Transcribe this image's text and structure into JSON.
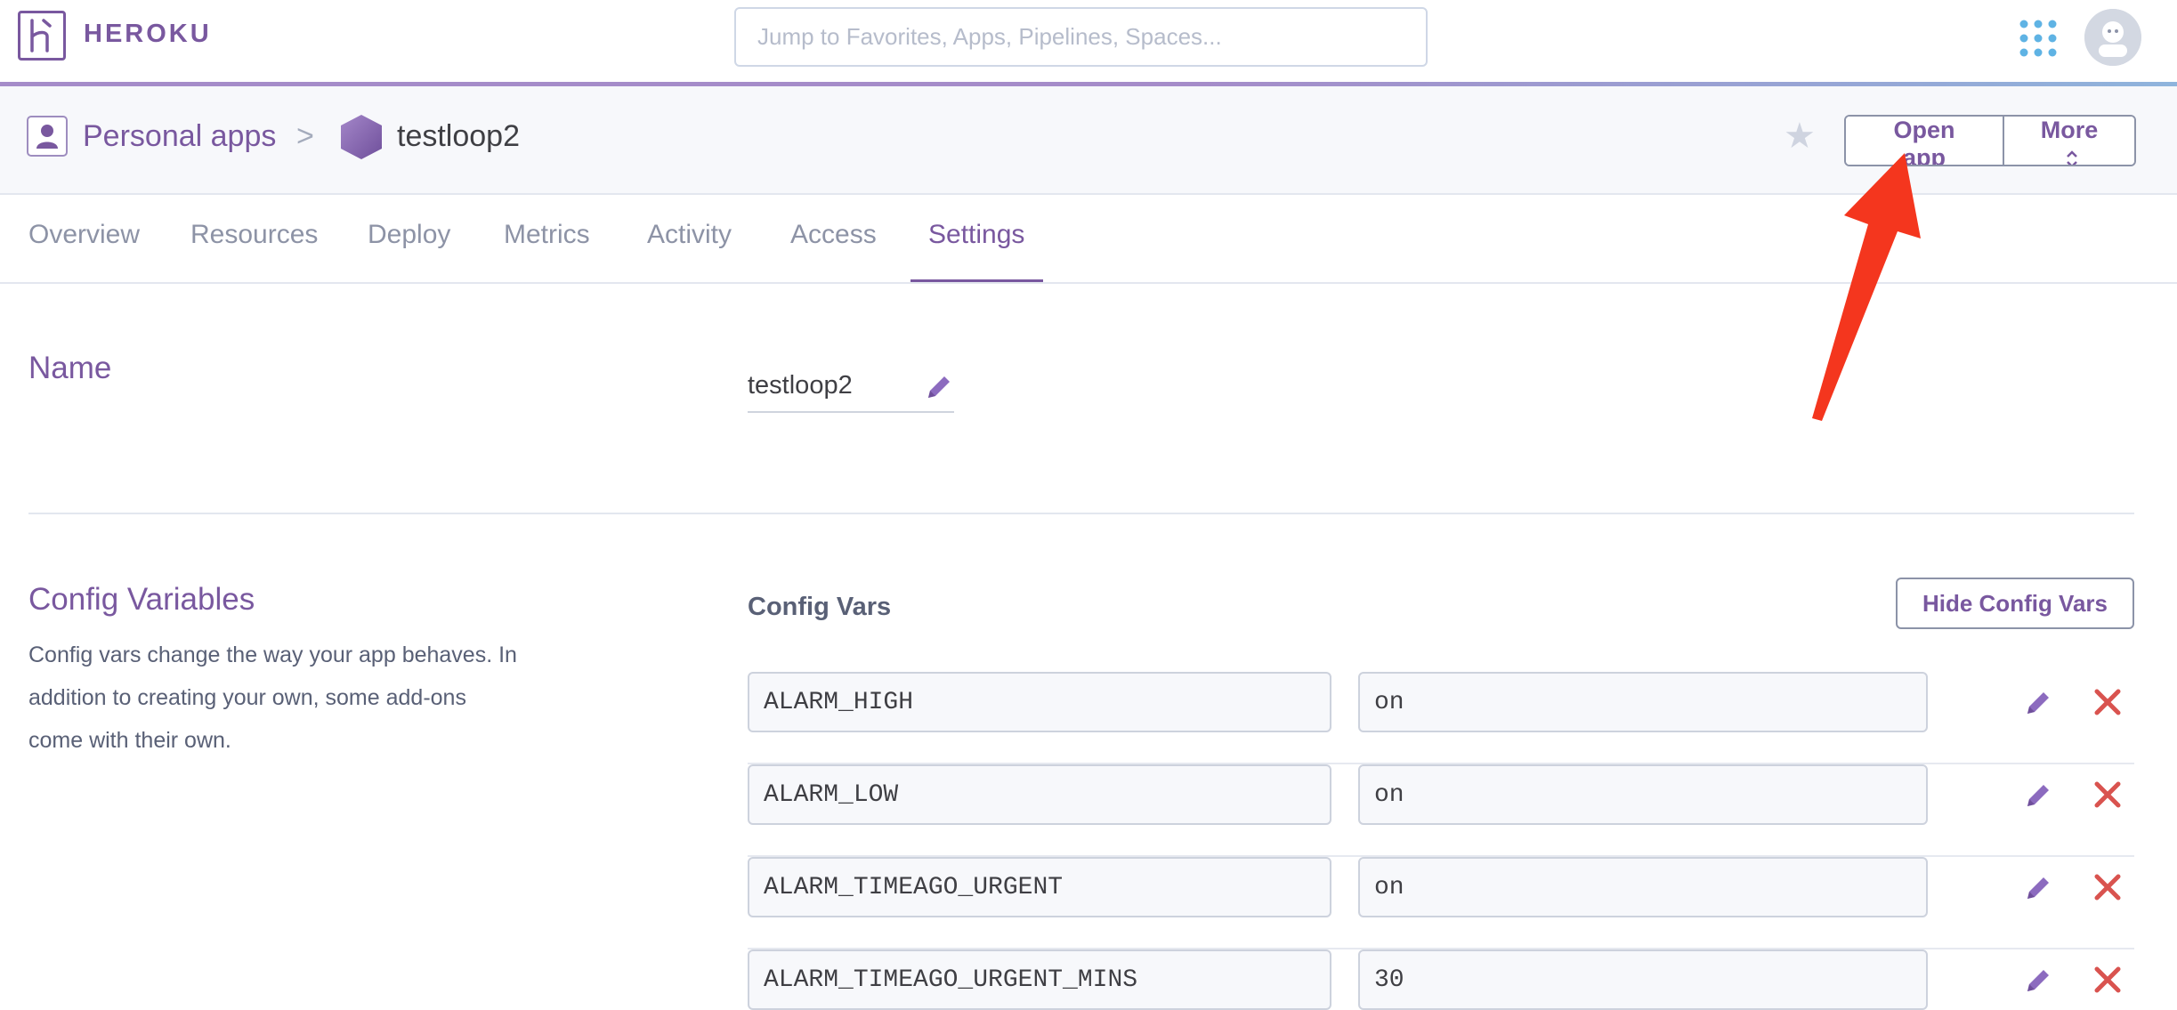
{
  "topbar": {
    "brand": "HEROKU",
    "search_placeholder": "Jump to Favorites, Apps, Pipelines, Spaces..."
  },
  "header": {
    "breadcrumb_root": "Personal apps",
    "breadcrumb_separator": ">",
    "app_name": "testloop2",
    "open_app_label": "Open app",
    "more_label": "More"
  },
  "tabs": [
    "Overview",
    "Resources",
    "Deploy",
    "Metrics",
    "Activity",
    "Access",
    "Settings"
  ],
  "active_tab": "Settings",
  "name_section": {
    "title": "Name",
    "value": "testloop2"
  },
  "config_section": {
    "title": "Config Variables",
    "description": "Config vars change the way your app behaves. In addition to creating your own, some add-ons come with their own.",
    "vars_label": "Config Vars",
    "hide_button": "Hide Config Vars",
    "vars": [
      {
        "key": "ALARM_HIGH",
        "value": "on"
      },
      {
        "key": "ALARM_LOW",
        "value": "on"
      },
      {
        "key": "ALARM_TIMEAGO_URGENT",
        "value": "on"
      },
      {
        "key": "ALARM_TIMEAGO_URGENT_MINS",
        "value": "30"
      }
    ]
  },
  "colors": {
    "brand_purple": "#79589f",
    "delete_red": "#d9534f",
    "annotation_arrow": "#f4361e"
  },
  "icons": [
    "heroku-logo-icon",
    "apps-grid-icon",
    "avatar",
    "user-icon",
    "app-hexagon-icon",
    "star-icon",
    "chevron-up-down-icon",
    "pencil-icon",
    "close-icon",
    "annotation-arrow"
  ]
}
